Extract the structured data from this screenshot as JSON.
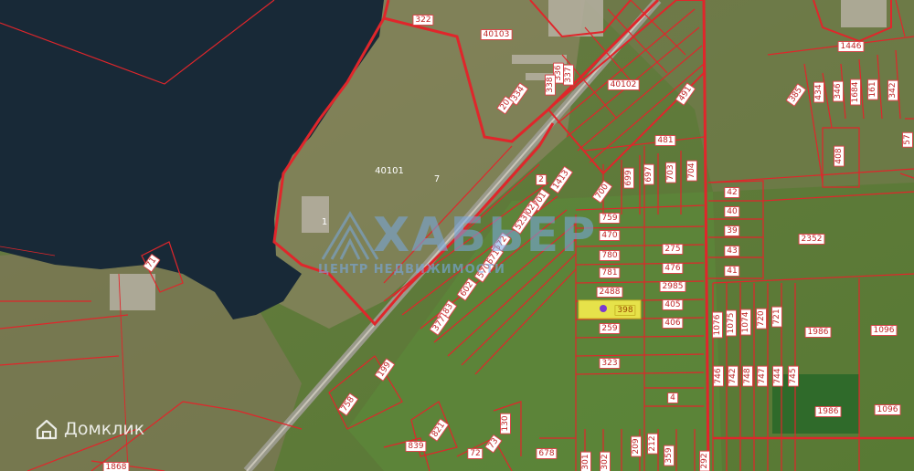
{
  "map": {
    "colors": {
      "parcel_border": "#e0262b",
      "selected_fill": "#e6e24a",
      "water": "#182937",
      "label_bg": "#ffffff"
    },
    "selected_parcel": "398",
    "watermark": {
      "title": "ХАБЬЕР",
      "subtitle": "ЦЕНТР НЕДВИЖИМОСТИ"
    },
    "brand": {
      "name": "Домклик",
      "icon": "house-logo-icon"
    },
    "labels": [
      {
        "text": "322"
      },
      {
        "text": "40103"
      },
      {
        "text": "40102"
      },
      {
        "text": "337"
      },
      {
        "text": "336"
      },
      {
        "text": "338"
      },
      {
        "text": "334"
      },
      {
        "text": "20"
      },
      {
        "text": "491"
      },
      {
        "text": "40101"
      },
      {
        "text": "7"
      },
      {
        "text": "2"
      },
      {
        "text": "1413"
      },
      {
        "text": "701"
      },
      {
        "text": "702"
      },
      {
        "text": "523"
      },
      {
        "text": "700"
      },
      {
        "text": "699"
      },
      {
        "text": "697"
      },
      {
        "text": "703"
      },
      {
        "text": "704"
      },
      {
        "text": "481"
      },
      {
        "text": "42"
      },
      {
        "text": "40"
      },
      {
        "text": "39"
      },
      {
        "text": "43"
      },
      {
        "text": "41"
      },
      {
        "text": "759"
      },
      {
        "text": "470"
      },
      {
        "text": "780"
      },
      {
        "text": "781"
      },
      {
        "text": "275"
      },
      {
        "text": "476"
      },
      {
        "text": "2488"
      },
      {
        "text": "2985"
      },
      {
        "text": "398"
      },
      {
        "text": "405"
      },
      {
        "text": "406"
      },
      {
        "text": "259"
      },
      {
        "text": "323"
      },
      {
        "text": "4"
      },
      {
        "text": "71"
      },
      {
        "text": "1"
      },
      {
        "text": "672"
      },
      {
        "text": "671"
      },
      {
        "text": "570"
      },
      {
        "text": "602"
      },
      {
        "text": "183"
      },
      {
        "text": "377"
      },
      {
        "text": "199"
      },
      {
        "text": "758"
      },
      {
        "text": "821"
      },
      {
        "text": "839"
      },
      {
        "text": "72"
      },
      {
        "text": "73"
      },
      {
        "text": "130"
      },
      {
        "text": "678"
      },
      {
        "text": "301"
      },
      {
        "text": "302"
      },
      {
        "text": "209"
      },
      {
        "text": "212"
      },
      {
        "text": "359"
      },
      {
        "text": "1446"
      },
      {
        "text": "385"
      },
      {
        "text": "434"
      },
      {
        "text": "346"
      },
      {
        "text": "1684"
      },
      {
        "text": "161"
      },
      {
        "text": "342"
      },
      {
        "text": "57"
      },
      {
        "text": "408"
      },
      {
        "text": "2352"
      },
      {
        "text": "1076"
      },
      {
        "text": "1075"
      },
      {
        "text": "1074"
      },
      {
        "text": "720"
      },
      {
        "text": "721"
      },
      {
        "text": "1986"
      },
      {
        "text": "1096"
      },
      {
        "text": "746"
      },
      {
        "text": "742"
      },
      {
        "text": "748"
      },
      {
        "text": "747"
      },
      {
        "text": "744"
      },
      {
        "text": "745"
      },
      {
        "text": "1986"
      },
      {
        "text": "1096"
      },
      {
        "text": "1868"
      },
      {
        "text": "292"
      }
    ]
  }
}
